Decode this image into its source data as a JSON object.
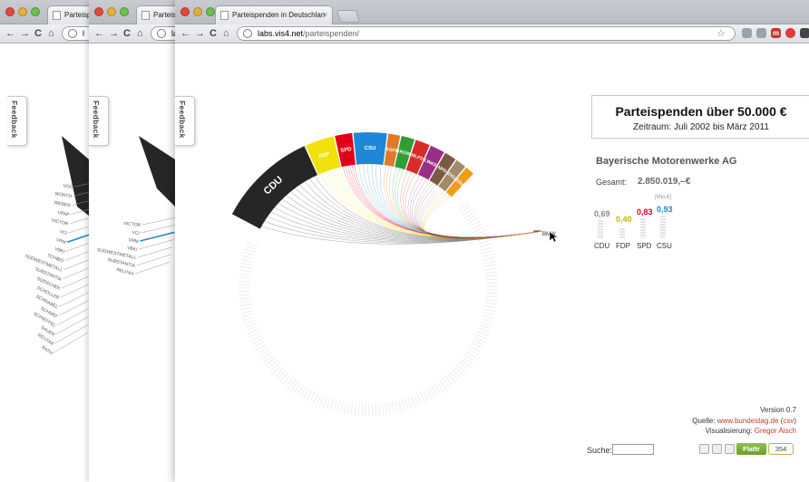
{
  "browser": {
    "windows": [
      {
        "tab_title": "Parteispe",
        "url_host": "l",
        "url_path": ""
      },
      {
        "tab_title": "Parteispe",
        "url_host": "lal",
        "url_path": ""
      },
      {
        "tab_title": "Parteispenden in Deutschlan",
        "url_host": "labs.vis4.net",
        "url_path": "/parteispenden/"
      }
    ],
    "extension_badge": "m"
  },
  "feedback_label": "Feedback",
  "parties": [
    "CDU",
    "FDP",
    "SPD",
    "CSU",
    "AGFS",
    "GRÜNE",
    "MLPD",
    "LINKE",
    "NPD",
    "DVU",
    "SSU"
  ],
  "party_colors": {
    "CDU": "#262626",
    "FDP": "#f2e10a",
    "SPD": "#e3001b",
    "CSU": "#1e87d7",
    "AGFS": "#e07a28",
    "GRÜNE": "#2f9e35",
    "MLPD": "#d92b2b",
    "LINKE": "#9b2f86",
    "NPD": "#7b5a44",
    "DVU": "#a38b6a",
    "SSU": "#f49b16"
  },
  "donor_marker": "BMW",
  "side_donors": [
    "VDC",
    "WÜRTH",
    "WEBER",
    "VPAP",
    "VICTOR",
    "VCI",
    "VRM",
    "VBKI",
    "TCHIBO",
    "SÜDWESTMETALL",
    "SUBSTANTIA",
    "SÜDSCHEK",
    "SCHÖLLER",
    "SCHNABEL",
    "SCHMID",
    "SCHIEFFEL",
    "SAUER",
    "REUTAX",
    "RATH"
  ],
  "side_donors_2": [
    "VICTOR",
    "VCI",
    "VRM",
    "VBKI",
    "SÜDWESTMETALL",
    "SUBSTANTIA",
    "REUTAX"
  ],
  "info": {
    "title": "Parteispenden über 50.000 €",
    "subtitle": "Zeitraum: Juli 2002 bis März 2011"
  },
  "donor": {
    "name": "Bayerische Motorenwerke AG",
    "total_label": "Gesamt:",
    "total_value": "2.850.019,–€",
    "unit": "[Mio.€]",
    "bars": [
      {
        "party": "CDU",
        "value": "0,69",
        "color": "#8a8a8a"
      },
      {
        "party": "FDP",
        "value": "0,40",
        "color": "#c5b800"
      },
      {
        "party": "SPD",
        "value": "0,83",
        "color": "#e3001b"
      },
      {
        "party": "CSU",
        "value": "0,93",
        "color": "#1e87d7"
      }
    ]
  },
  "footer": {
    "version": "Version 0.7",
    "source_label": "Quelle:",
    "source_link": "www.bundestag.de",
    "csv_label": "csv",
    "viz_label": "Visualisierung:",
    "viz_author": "Gregor Aisch",
    "search_label": "Suche:",
    "flattr_label": "Flattr",
    "flattr_count": "354"
  }
}
